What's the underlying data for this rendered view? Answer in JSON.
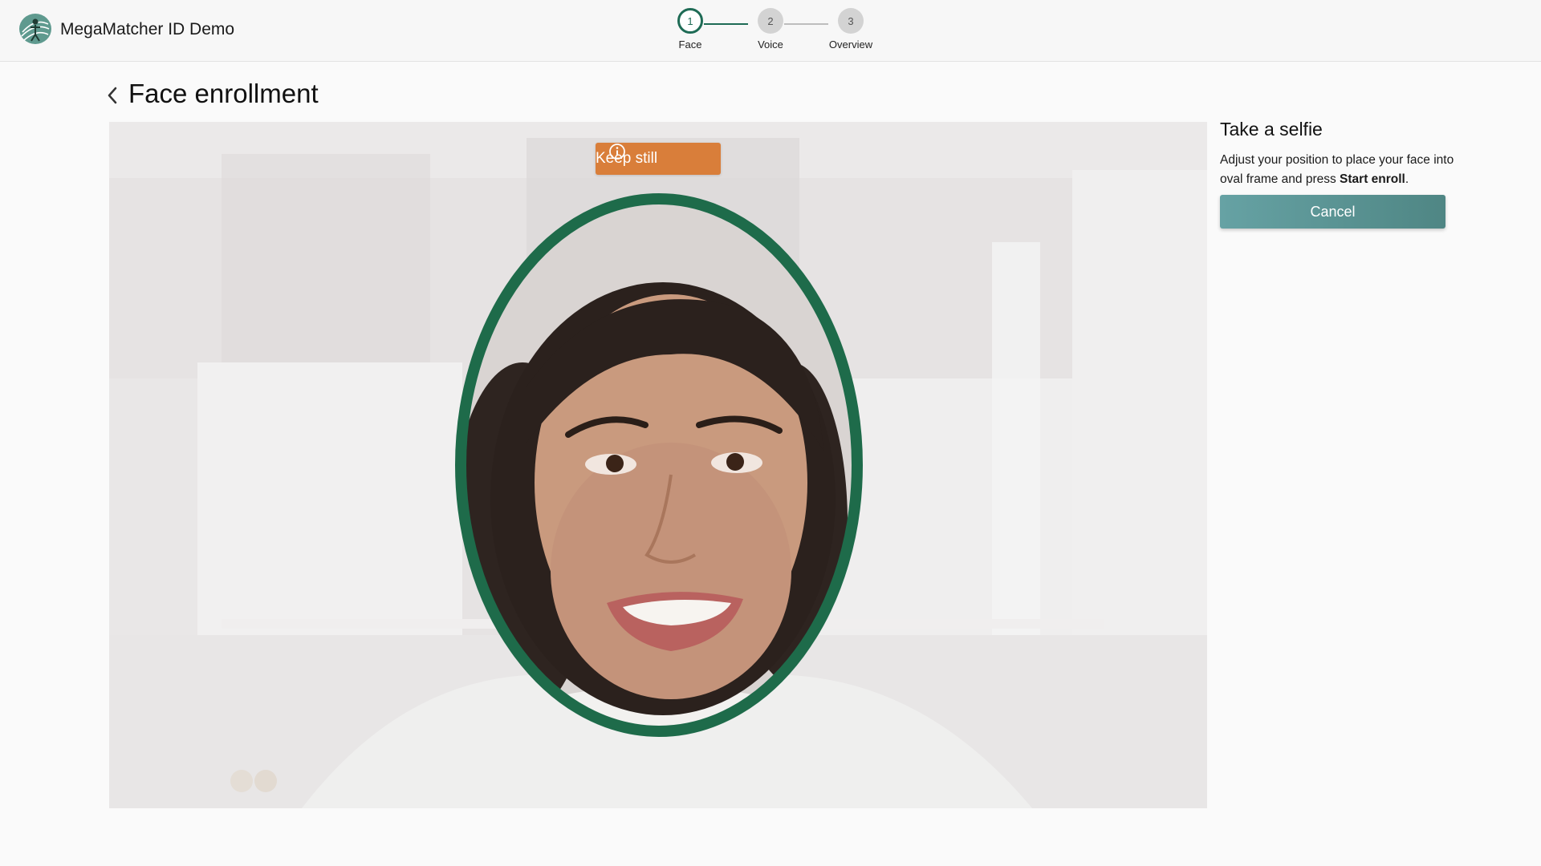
{
  "header": {
    "app_title": "MegaMatcher ID Demo",
    "logo_icon": "fingerprint-person-logo"
  },
  "stepper": {
    "steps": [
      {
        "number": "1",
        "label": "Face",
        "state": "active"
      },
      {
        "number": "2",
        "label": "Voice",
        "state": "pending"
      },
      {
        "number": "3",
        "label": "Overview",
        "state": "pending"
      }
    ]
  },
  "page": {
    "title": "Face enrollment",
    "back_icon": "chevron-left-icon"
  },
  "camera": {
    "toast_text": "Keep still",
    "toast_icon": "info-icon",
    "oval_color": "#1e6b4a"
  },
  "side_panel": {
    "title": "Take a selfie",
    "description_prefix": "Adjust your position to place your face into oval frame and press ",
    "description_bold": "Start enroll",
    "description_suffix": ".",
    "cancel_label": "Cancel"
  },
  "colors": {
    "accent": "#1e6b55",
    "toast": "#d97e3a",
    "button_start": "#66a2a4",
    "button_end": "#4f8684"
  }
}
